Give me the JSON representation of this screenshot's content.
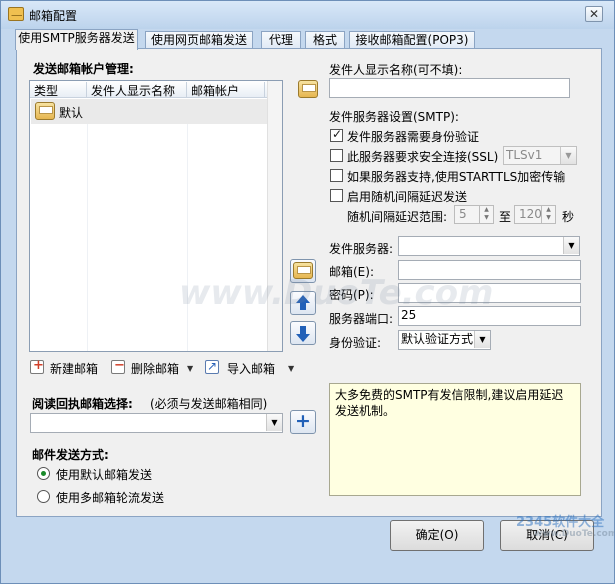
{
  "window": {
    "title": "邮箱配置",
    "close_glyph": "✕"
  },
  "tabs": [
    "使用SMTP服务器发送",
    "使用网页邮箱发送",
    "代理",
    "格式",
    "接收邮箱配置(POP3)"
  ],
  "accounts": {
    "section_label": "发送邮箱帐户管理:",
    "columns": [
      "类型",
      "发件人显示名称",
      "邮箱帐户"
    ],
    "rows": [
      {
        "type": "默认",
        "display_name": "",
        "account": ""
      }
    ],
    "new_label": "新建邮箱",
    "delete_label": "删除邮箱",
    "import_label": "导入邮箱",
    "dropdown_glyph": "▼"
  },
  "sender_name": {
    "label": "发件人显示名称(可不填):",
    "value": ""
  },
  "smtp": {
    "section_label": "发件服务器设置(SMTP):",
    "auth_label": "发件服务器需要身份验证",
    "auth_checked": true,
    "ssl_label": "此服务器要求安全连接(SSL)",
    "ssl_checked": false,
    "ssl_version": "TLSv1",
    "starttls_label": "如果服务器支持,使用STARTTLS加密传输",
    "starttls_checked": false,
    "delay_label": "启用随机间隔延迟发送",
    "delay_checked": false,
    "range_label": "随机间隔延迟范围:",
    "range_min": "5",
    "range_to": "至",
    "range_max": "120",
    "range_unit": "秒"
  },
  "server": {
    "server_label": "发件服务器:",
    "server_value": "",
    "email_label": "邮箱(E):",
    "email_value": "",
    "password_label": "密码(P):",
    "password_value": "",
    "port_label": "服务器端口:",
    "port_value": "25",
    "auth_label": "身份验证:",
    "auth_value": "默认验证方式"
  },
  "receipt": {
    "label": "阅读回执邮箱选择:",
    "hint": "(必须与发送邮箱相同)",
    "value": ""
  },
  "send_mode": {
    "label": "邮件发送方式:",
    "options": [
      "使用默认邮箱发送",
      "使用多邮箱轮流发送"
    ],
    "selected": 0
  },
  "note": "大多免费的SMTP有发信限制,建议启用延迟发送机制。",
  "buttons": {
    "ok": "确定(O)",
    "cancel": "取消(C)"
  },
  "watermarks": {
    "center": "www.DuoTe.com",
    "corner": "2345软件大全",
    "corner_sub": "www.DuoTe.com"
  }
}
